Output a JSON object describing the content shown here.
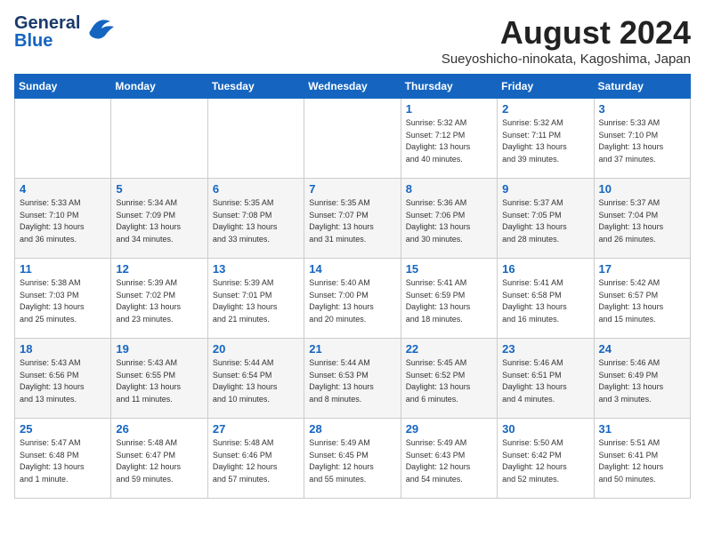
{
  "header": {
    "logo_line1": "General",
    "logo_line2": "Blue",
    "cal_title": "August 2024",
    "cal_subtitle": "Sueyoshicho-ninokata, Kagoshima, Japan"
  },
  "weekdays": [
    "Sunday",
    "Monday",
    "Tuesday",
    "Wednesday",
    "Thursday",
    "Friday",
    "Saturday"
  ],
  "weeks": [
    [
      {
        "day": "",
        "info": ""
      },
      {
        "day": "",
        "info": ""
      },
      {
        "day": "",
        "info": ""
      },
      {
        "day": "",
        "info": ""
      },
      {
        "day": "1",
        "info": "Sunrise: 5:32 AM\nSunset: 7:12 PM\nDaylight: 13 hours\nand 40 minutes."
      },
      {
        "day": "2",
        "info": "Sunrise: 5:32 AM\nSunset: 7:11 PM\nDaylight: 13 hours\nand 39 minutes."
      },
      {
        "day": "3",
        "info": "Sunrise: 5:33 AM\nSunset: 7:10 PM\nDaylight: 13 hours\nand 37 minutes."
      }
    ],
    [
      {
        "day": "4",
        "info": "Sunrise: 5:33 AM\nSunset: 7:10 PM\nDaylight: 13 hours\nand 36 minutes."
      },
      {
        "day": "5",
        "info": "Sunrise: 5:34 AM\nSunset: 7:09 PM\nDaylight: 13 hours\nand 34 minutes."
      },
      {
        "day": "6",
        "info": "Sunrise: 5:35 AM\nSunset: 7:08 PM\nDaylight: 13 hours\nand 33 minutes."
      },
      {
        "day": "7",
        "info": "Sunrise: 5:35 AM\nSunset: 7:07 PM\nDaylight: 13 hours\nand 31 minutes."
      },
      {
        "day": "8",
        "info": "Sunrise: 5:36 AM\nSunset: 7:06 PM\nDaylight: 13 hours\nand 30 minutes."
      },
      {
        "day": "9",
        "info": "Sunrise: 5:37 AM\nSunset: 7:05 PM\nDaylight: 13 hours\nand 28 minutes."
      },
      {
        "day": "10",
        "info": "Sunrise: 5:37 AM\nSunset: 7:04 PM\nDaylight: 13 hours\nand 26 minutes."
      }
    ],
    [
      {
        "day": "11",
        "info": "Sunrise: 5:38 AM\nSunset: 7:03 PM\nDaylight: 13 hours\nand 25 minutes."
      },
      {
        "day": "12",
        "info": "Sunrise: 5:39 AM\nSunset: 7:02 PM\nDaylight: 13 hours\nand 23 minutes."
      },
      {
        "day": "13",
        "info": "Sunrise: 5:39 AM\nSunset: 7:01 PM\nDaylight: 13 hours\nand 21 minutes."
      },
      {
        "day": "14",
        "info": "Sunrise: 5:40 AM\nSunset: 7:00 PM\nDaylight: 13 hours\nand 20 minutes."
      },
      {
        "day": "15",
        "info": "Sunrise: 5:41 AM\nSunset: 6:59 PM\nDaylight: 13 hours\nand 18 minutes."
      },
      {
        "day": "16",
        "info": "Sunrise: 5:41 AM\nSunset: 6:58 PM\nDaylight: 13 hours\nand 16 minutes."
      },
      {
        "day": "17",
        "info": "Sunrise: 5:42 AM\nSunset: 6:57 PM\nDaylight: 13 hours\nand 15 minutes."
      }
    ],
    [
      {
        "day": "18",
        "info": "Sunrise: 5:43 AM\nSunset: 6:56 PM\nDaylight: 13 hours\nand 13 minutes."
      },
      {
        "day": "19",
        "info": "Sunrise: 5:43 AM\nSunset: 6:55 PM\nDaylight: 13 hours\nand 11 minutes."
      },
      {
        "day": "20",
        "info": "Sunrise: 5:44 AM\nSunset: 6:54 PM\nDaylight: 13 hours\nand 10 minutes."
      },
      {
        "day": "21",
        "info": "Sunrise: 5:44 AM\nSunset: 6:53 PM\nDaylight: 13 hours\nand 8 minutes."
      },
      {
        "day": "22",
        "info": "Sunrise: 5:45 AM\nSunset: 6:52 PM\nDaylight: 13 hours\nand 6 minutes."
      },
      {
        "day": "23",
        "info": "Sunrise: 5:46 AM\nSunset: 6:51 PM\nDaylight: 13 hours\nand 4 minutes."
      },
      {
        "day": "24",
        "info": "Sunrise: 5:46 AM\nSunset: 6:49 PM\nDaylight: 13 hours\nand 3 minutes."
      }
    ],
    [
      {
        "day": "25",
        "info": "Sunrise: 5:47 AM\nSunset: 6:48 PM\nDaylight: 13 hours\nand 1 minute."
      },
      {
        "day": "26",
        "info": "Sunrise: 5:48 AM\nSunset: 6:47 PM\nDaylight: 12 hours\nand 59 minutes."
      },
      {
        "day": "27",
        "info": "Sunrise: 5:48 AM\nSunset: 6:46 PM\nDaylight: 12 hours\nand 57 minutes."
      },
      {
        "day": "28",
        "info": "Sunrise: 5:49 AM\nSunset: 6:45 PM\nDaylight: 12 hours\nand 55 minutes."
      },
      {
        "day": "29",
        "info": "Sunrise: 5:49 AM\nSunset: 6:43 PM\nDaylight: 12 hours\nand 54 minutes."
      },
      {
        "day": "30",
        "info": "Sunrise: 5:50 AM\nSunset: 6:42 PM\nDaylight: 12 hours\nand 52 minutes."
      },
      {
        "day": "31",
        "info": "Sunrise: 5:51 AM\nSunset: 6:41 PM\nDaylight: 12 hours\nand 50 minutes."
      }
    ]
  ]
}
